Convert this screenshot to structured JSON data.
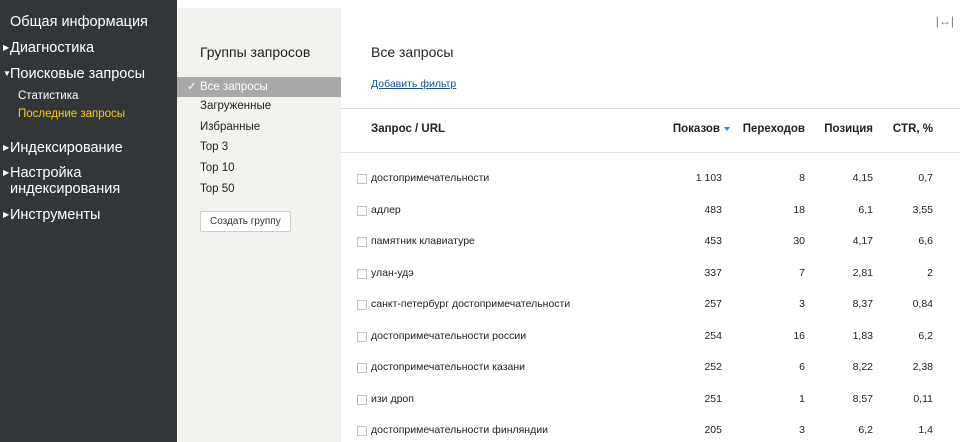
{
  "sidebar": {
    "overview": "Общая информация",
    "diagnostics": "Диагностика",
    "search_queries": "Поисковые запросы",
    "sub_statistics": "Статистика",
    "sub_recent": "Последние запросы",
    "indexing": "Индексирование",
    "indexing_settings_line1": "Настройка",
    "indexing_settings_line2": "индексирования",
    "tools": "Инструменты",
    "active_color": "#ffcc00",
    "bg_color": "#333639"
  },
  "groups": {
    "title": "Группы запросов",
    "items": [
      "Все запросы",
      "Загруженные",
      "Избранные",
      "Top 3",
      "Top 10",
      "Top 50"
    ],
    "selected_index": 0,
    "create_button": "Создать группу"
  },
  "main": {
    "title": "Все запросы",
    "add_filter": "Добавить фильтр",
    "columns": {
      "query": "Запрос / URL",
      "shows": "Показов",
      "clicks": "Переходов",
      "position": "Позиция",
      "ctr": "CTR, %"
    },
    "sort_column": "shows",
    "rows": [
      {
        "query": "достопримечательности",
        "shows": "1 103",
        "clicks": "8",
        "position": "4,15",
        "ctr": "0,7"
      },
      {
        "query": "адлер",
        "shows": "483",
        "clicks": "18",
        "position": "6,1",
        "ctr": "3,55"
      },
      {
        "query": "памятник клавиатуре",
        "shows": "453",
        "clicks": "30",
        "position": "4,17",
        "ctr": "6,6"
      },
      {
        "query": "улан-удэ",
        "shows": "337",
        "clicks": "7",
        "position": "2,81",
        "ctr": "2"
      },
      {
        "query": "санкт-петербург достопримечательности",
        "shows": "257",
        "clicks": "3",
        "position": "8,37",
        "ctr": "0,84"
      },
      {
        "query": "достопримечательности россии",
        "shows": "254",
        "clicks": "16",
        "position": "1,83",
        "ctr": "6,2"
      },
      {
        "query": "достопримечательности казани",
        "shows": "252",
        "clicks": "6",
        "position": "8,22",
        "ctr": "2,38"
      },
      {
        "query": "изи дроп",
        "shows": "251",
        "clicks": "1",
        "position": "8,57",
        "ctr": "0,11"
      },
      {
        "query": "достопримечательности финляндии",
        "shows": "205",
        "clicks": "3",
        "position": "6,2",
        "ctr": "1,4"
      }
    ]
  },
  "icons": {
    "expand": "|↔|",
    "check": "✓"
  },
  "colors": {
    "link": "#1a4ea3",
    "sort_arrow": "#3c7ed8",
    "selected_group_bg": "#a8a9ab"
  }
}
